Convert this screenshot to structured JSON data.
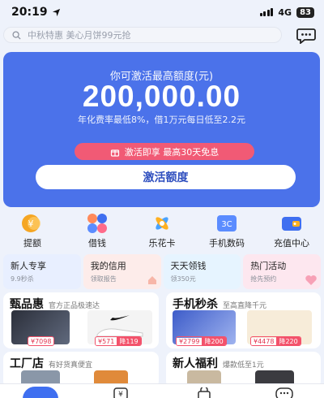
{
  "status": {
    "time": "20:19",
    "network": "4G",
    "battery": "83"
  },
  "search": {
    "placeholder": "中秋特惠 美心月饼99元抢"
  },
  "hero": {
    "subtitle": "你可激活最高额度(元)",
    "amount": "200,000.00",
    "rate_text": "年化费率最低8%，借1万元每日低至2.2元",
    "promo": "激活即享 最高30天免息",
    "button": "激活额度"
  },
  "quick_actions": [
    {
      "label": "提额",
      "icon": "yen-coin-icon"
    },
    {
      "label": "借钱",
      "icon": "petal-grid-icon"
    },
    {
      "label": "乐花卡",
      "icon": "flower-icon"
    },
    {
      "label": "手机数码",
      "icon": "3c-badge-icon",
      "badge": "3C"
    },
    {
      "label": "充值中心",
      "icon": "wallet-icon"
    }
  ],
  "cards": [
    {
      "title": "新人专享",
      "sub": "9.9秒杀"
    },
    {
      "title": "我的信用",
      "sub": "领取报告"
    },
    {
      "title": "天天领钱",
      "sub": "领350元"
    },
    {
      "title": "热门活动",
      "sub": "抢先预约"
    }
  ],
  "panels": {
    "selection": {
      "title": "甄品惠",
      "tag": "官方正品极速达",
      "prices": [
        "¥7098",
        "¥571",
        "降119"
      ]
    },
    "flash": {
      "title": "手机秒杀",
      "tag": "至高直降千元",
      "prices": [
        "¥2799",
        "降200",
        "¥4478",
        "降220"
      ]
    },
    "factory": {
      "title": "工厂店",
      "tag": "有好货真便宜"
    },
    "newbie": {
      "title": "新人福利",
      "tag": "爆款低至1元"
    }
  },
  "nav": [
    {
      "name": "home"
    },
    {
      "name": "yen"
    },
    {
      "name": "bag"
    },
    {
      "name": "chat"
    }
  ],
  "colors": {
    "primary": "#4b72ea",
    "promo": "#f15a75",
    "price": "#e23550"
  }
}
